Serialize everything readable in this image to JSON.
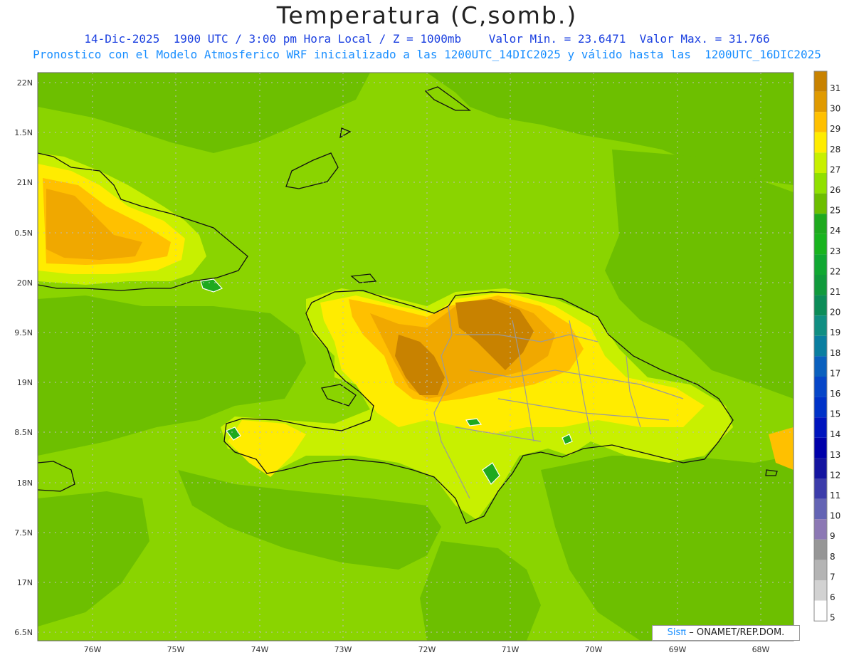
{
  "header": {
    "title": "Temperatura (C,somb.)",
    "subtitle_line1": "14-Dic-2025  1900 UTC / 3:00 pm Hora Local / Z = 1000mb    Valor Min. = 23.6471  Valor Max. = 31.766",
    "subtitle_line2": "Pronostico con el Modelo Atmosferico WRF inicializado a las 1200UTC_14DIC2025 y válido hasta las  1200UTC_16DIC2025"
  },
  "axes": {
    "lat_labels": [
      "22N",
      "1.5N",
      "21N",
      "0.5N",
      "20N",
      "9.5N",
      "19N",
      "8.5N",
      "18N",
      "7.5N",
      "17N",
      "6.5N"
    ],
    "lon_labels": [
      "76W",
      "75W",
      "74W",
      "73W",
      "72W",
      "71W",
      "70W",
      "69W",
      "68W"
    ]
  },
  "colorbar": {
    "labels": [
      "31",
      "30",
      "29",
      "28",
      "27",
      "26",
      "25",
      "24",
      "23",
      "22",
      "21",
      "20",
      "19",
      "18",
      "17",
      "16",
      "15",
      "14",
      "13",
      "12",
      "11",
      "10",
      "9",
      "8",
      "7",
      "6",
      "5"
    ],
    "colors": [
      "#c88200",
      "#e09a00",
      "#ffc000",
      "#ffec00",
      "#c8f000",
      "#90e000",
      "#6cbe00",
      "#1eaa1e",
      "#18b41e",
      "#10a832",
      "#109a3c",
      "#0c8c58",
      "#108e82",
      "#0a7ea0",
      "#0a60be",
      "#0646c8",
      "#0032c8",
      "#0014be",
      "#0000aa",
      "#1414a0",
      "#3c3caa",
      "#6464b4",
      "#8c78b4",
      "#969696",
      "#b4b4b4",
      "#d2d2d2",
      "#ffffff"
    ]
  },
  "credit": {
    "sis": "Sisπ",
    "text": "– ONAMET/REP.DOM."
  },
  "legend_colors": {
    "ocean": "#8ad400",
    "ocean_dark": "#6cbe00",
    "warm_orange": "#f0a800",
    "yellow": "#ffe000",
    "brown": "#c88200",
    "green_cold": "#1eaa1e"
  }
}
